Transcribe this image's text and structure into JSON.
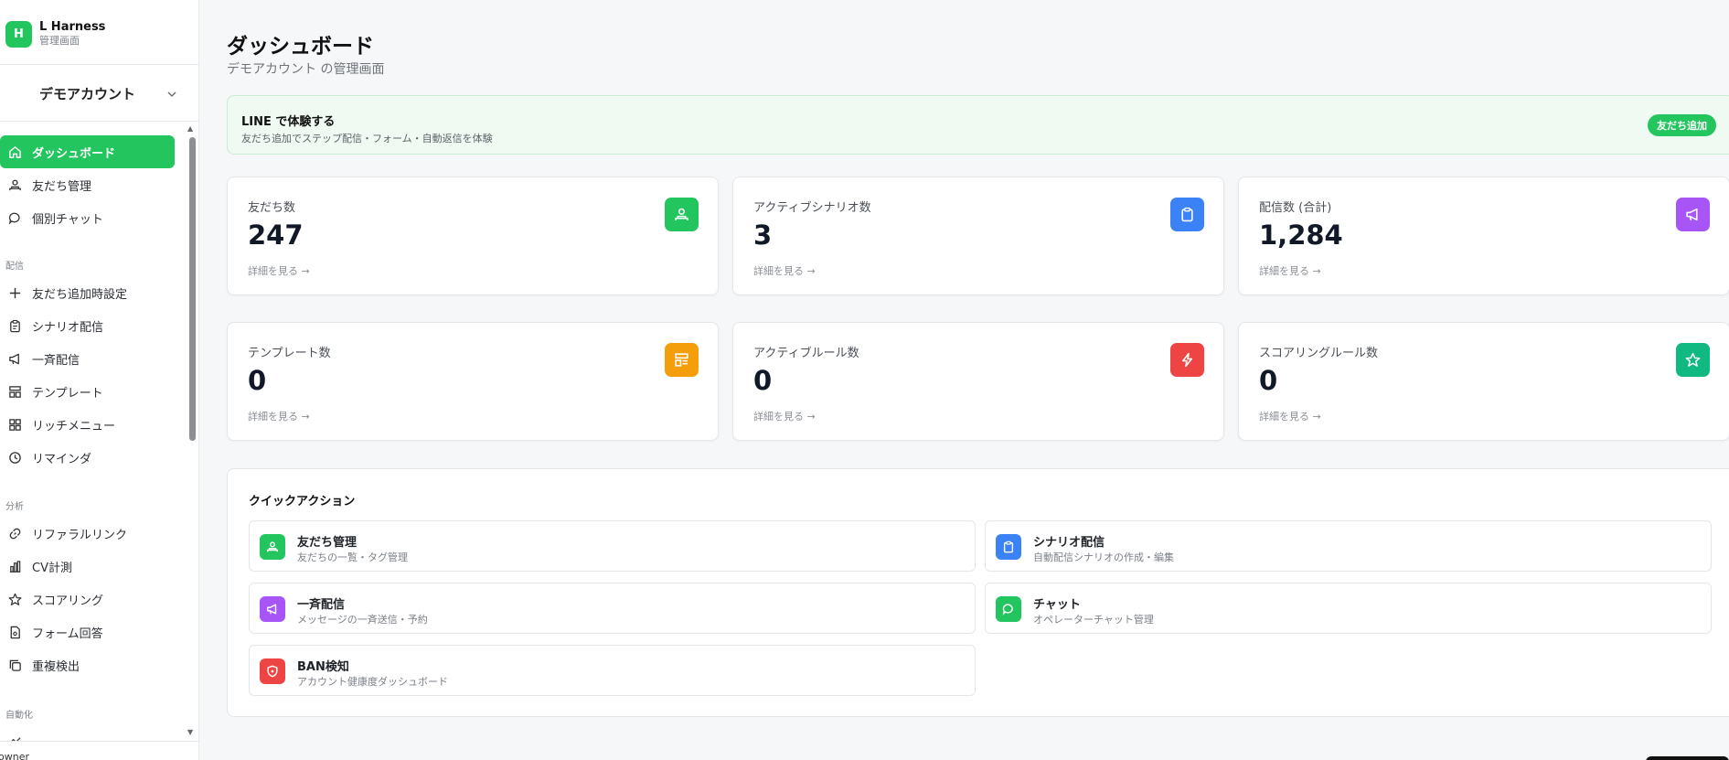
{
  "brand": {
    "logo_letter": "H",
    "name": "L Harness",
    "subtitle": "管理画面"
  },
  "account": {
    "name": "デモアカウント"
  },
  "nav": {
    "items_main": [
      {
        "label": "ダッシュボード",
        "icon": "home-icon"
      },
      {
        "label": "友だち管理",
        "icon": "users-icon"
      },
      {
        "label": "個別チャット",
        "icon": "chat-icon"
      }
    ],
    "section_delivery": "配信",
    "items_delivery": [
      {
        "label": "友だち追加時設定",
        "icon": "plus-icon"
      },
      {
        "label": "シナリオ配信",
        "icon": "clipboard-icon"
      },
      {
        "label": "一斉配信",
        "icon": "megaphone-icon"
      },
      {
        "label": "テンプレート",
        "icon": "template-icon"
      },
      {
        "label": "リッチメニュー",
        "icon": "grid-icon"
      },
      {
        "label": "リマインダ",
        "icon": "clock-icon"
      }
    ],
    "section_analysis": "分析",
    "items_analysis": [
      {
        "label": "リファラルリンク",
        "icon": "link-icon"
      },
      {
        "label": "CV計測",
        "icon": "bar-chart-icon"
      },
      {
        "label": "スコアリング",
        "icon": "star-icon"
      },
      {
        "label": "フォーム回答",
        "icon": "form-icon"
      },
      {
        "label": "重複検出",
        "icon": "copy-icon"
      }
    ],
    "section_automation": "自動化"
  },
  "footer": {
    "owner_text": "owner"
  },
  "header": {
    "title": "ダッシュボード",
    "subtitle": "デモアカウント の管理画面"
  },
  "banner": {
    "title": "LINE で体験する",
    "description": "友だち追加でステップ配信・フォーム・自動返信を体験",
    "button": "友だち追加"
  },
  "stats": [
    {
      "label": "友だち数",
      "value": "247",
      "link": "詳細を見る →",
      "icon": "users-icon",
      "color": "#22c55e"
    },
    {
      "label": "アクティブシナリオ数",
      "value": "3",
      "link": "詳細を見る →",
      "icon": "clipboard-icon",
      "color": "#3b82f6"
    },
    {
      "label": "配信数 (合計)",
      "value": "1,284",
      "link": "詳細を見る →",
      "icon": "megaphone-icon",
      "color": "#a855f7"
    },
    {
      "label": "テンプレート数",
      "value": "0",
      "link": "詳細を見る →",
      "icon": "template-icon",
      "color": "#f59e0b"
    },
    {
      "label": "アクティブルール数",
      "value": "0",
      "link": "詳細を見る →",
      "icon": "bolt-icon",
      "color": "#ef4444"
    },
    {
      "label": "スコアリングルール数",
      "value": "0",
      "link": "詳細を見る →",
      "icon": "star-icon",
      "color": "#10b981"
    }
  ],
  "quick_actions": {
    "title": "クイックアクション",
    "items": [
      {
        "name": "友だち管理",
        "desc": "友だちの一覧・タグ管理",
        "icon": "users-icon",
        "color": "#22c55e"
      },
      {
        "name": "シナリオ配信",
        "desc": "自動配信シナリオの作成・編集",
        "icon": "clipboard-icon",
        "color": "#3b82f6"
      },
      {
        "name": "一斉配信",
        "desc": "メッセージの一斉送信・予約",
        "icon": "megaphone-icon",
        "color": "#a855f7"
      },
      {
        "name": "チャット",
        "desc": "オペレーターチャット管理",
        "icon": "chat-icon",
        "color": "#22c55e"
      },
      {
        "name": "BAN検知",
        "desc": "アカウント健康度ダッシュボード",
        "icon": "shield-icon",
        "color": "#ef4444"
      }
    ]
  },
  "colors": {
    "accent": "#22c55e",
    "banner_bg": "#effaf2"
  }
}
